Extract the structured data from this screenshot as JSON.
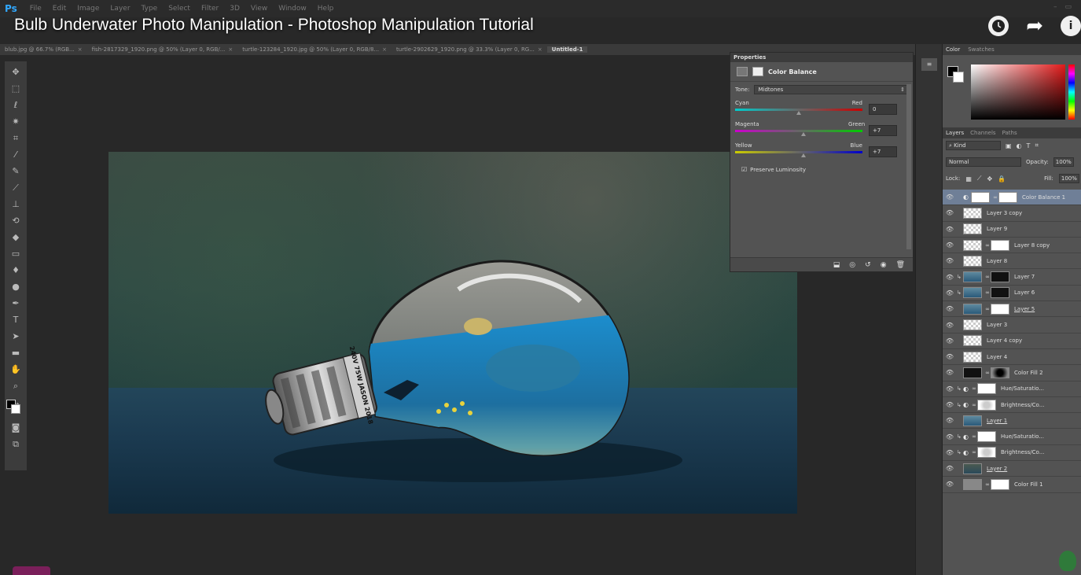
{
  "app": {
    "logo": "Ps",
    "menu": [
      "File",
      "Edit",
      "Image",
      "Layer",
      "Type",
      "Select",
      "Filter",
      "3D",
      "View",
      "Window",
      "Help"
    ]
  },
  "video": {
    "title": "Bulb Underwater Photo Manipulation - Photoshop Manipulation Tutorial",
    "info_label": "i"
  },
  "tabs": [
    {
      "label": "blub.jpg @ 66.7% (RGB...",
      "close": "×"
    },
    {
      "label": "fish-2817329_1920.png @ 50% (Layer 0, RGB/...",
      "close": "×"
    },
    {
      "label": "turtle-123284_1920.jpg @ 50% (Layer 0, RGB/8...",
      "close": "×"
    },
    {
      "label": "turtle-2902629_1920.png @ 33.3% (Layer 0, RG...",
      "close": "×"
    },
    {
      "label": "Untitled-1",
      "close": ""
    }
  ],
  "canvas": {
    "bulb_base_text": "240V 75W JASON 2018"
  },
  "properties": {
    "panel_title": "Properties",
    "adjustment_name": "Color Balance",
    "tone_label": "Tone:",
    "tone_value": "Midtones",
    "sliders": [
      {
        "left": "Cyan",
        "right": "Red",
        "value": "0",
        "level": 0
      },
      {
        "left": "Magenta",
        "right": "Green",
        "value": "+7",
        "level": 7
      },
      {
        "left": "Yellow",
        "right": "Blue",
        "value": "+7",
        "level": 7
      }
    ],
    "preserve_label": "Preserve Luminosity",
    "preserve_checked": true
  },
  "color_panel": {
    "tabs": [
      "Color",
      "Swatches"
    ],
    "active_tab": "Color",
    "foreground": "#000000",
    "background": "#ffffff"
  },
  "layers_panel": {
    "tabs": [
      "Layers",
      "Channels",
      "Paths"
    ],
    "kind": "Kind",
    "blend_mode": "Normal",
    "opacity_label": "Opacity:",
    "opacity_value": "100%",
    "lock_label": "Lock:",
    "fill_label": "Fill:",
    "fill_value": "100%",
    "layers": [
      {
        "name": "Color Balance 1",
        "selected": true,
        "clip": false,
        "adj": true,
        "thumb": "white",
        "chain": true,
        "mask": "white",
        "underline": false
      },
      {
        "name": "Layer 3 copy",
        "selected": false,
        "clip": false,
        "adj": false,
        "thumb": "trans",
        "chain": false,
        "mask": "",
        "underline": false
      },
      {
        "name": "Layer 9",
        "selected": false,
        "clip": false,
        "adj": false,
        "thumb": "trans",
        "chain": false,
        "mask": "",
        "underline": false
      },
      {
        "name": "Layer 8 copy",
        "selected": false,
        "clip": false,
        "adj": false,
        "thumb": "trans",
        "chain": true,
        "mask": "white",
        "underline": false
      },
      {
        "name": "Layer 8",
        "selected": false,
        "clip": false,
        "adj": false,
        "thumb": "trans",
        "chain": false,
        "mask": "",
        "underline": false
      },
      {
        "name": "Layer 7",
        "selected": false,
        "clip": true,
        "adj": false,
        "thumb": "photo",
        "chain": true,
        "mask": "black",
        "underline": false
      },
      {
        "name": "Layer 6",
        "selected": false,
        "clip": true,
        "adj": false,
        "thumb": "photo",
        "chain": true,
        "mask": "black",
        "underline": false
      },
      {
        "name": "Layer 5",
        "selected": false,
        "clip": false,
        "adj": false,
        "thumb": "photo",
        "chain": true,
        "mask": "white",
        "underline": true
      },
      {
        "name": "Layer 3",
        "selected": false,
        "clip": false,
        "adj": false,
        "thumb": "trans",
        "chain": false,
        "mask": "",
        "underline": false
      },
      {
        "name": "Layer 4 copy",
        "selected": false,
        "clip": false,
        "adj": false,
        "thumb": "trans",
        "chain": false,
        "mask": "",
        "underline": false
      },
      {
        "name": "Layer 4",
        "selected": false,
        "clip": false,
        "adj": false,
        "thumb": "trans",
        "chain": false,
        "mask": "",
        "underline": false
      },
      {
        "name": "Color Fill 2",
        "selected": false,
        "clip": false,
        "adj": false,
        "thumb": "black",
        "chain": true,
        "mask": "grad",
        "underline": false
      },
      {
        "name": "Hue/Saturatio...",
        "selected": false,
        "clip": true,
        "adj": true,
        "thumb": "",
        "chain": true,
        "mask": "white",
        "underline": false
      },
      {
        "name": "Brightness/Co...",
        "selected": false,
        "clip": true,
        "adj": true,
        "thumb": "",
        "chain": true,
        "mask": "soft",
        "underline": false
      },
      {
        "name": "Layer 1",
        "selected": false,
        "clip": false,
        "adj": false,
        "thumb": "photo",
        "chain": false,
        "mask": "",
        "underline": true
      },
      {
        "name": "Hue/Saturatio...",
        "selected": false,
        "clip": true,
        "adj": true,
        "thumb": "",
        "chain": true,
        "mask": "white",
        "underline": false
      },
      {
        "name": "Brightness/Co...",
        "selected": false,
        "clip": true,
        "adj": true,
        "thumb": "",
        "chain": true,
        "mask": "soft",
        "underline": false
      },
      {
        "name": "Layer 2",
        "selected": false,
        "clip": false,
        "adj": false,
        "thumb": "scene",
        "chain": false,
        "mask": "",
        "underline": true
      },
      {
        "name": "Color Fill 1",
        "selected": false,
        "clip": false,
        "adj": false,
        "thumb": "gray",
        "chain": true,
        "mask": "white",
        "underline": false
      }
    ]
  },
  "icons": {
    "clock": "clock-icon",
    "share": "share-icon",
    "info": "info-icon",
    "eye": "eye-icon"
  }
}
